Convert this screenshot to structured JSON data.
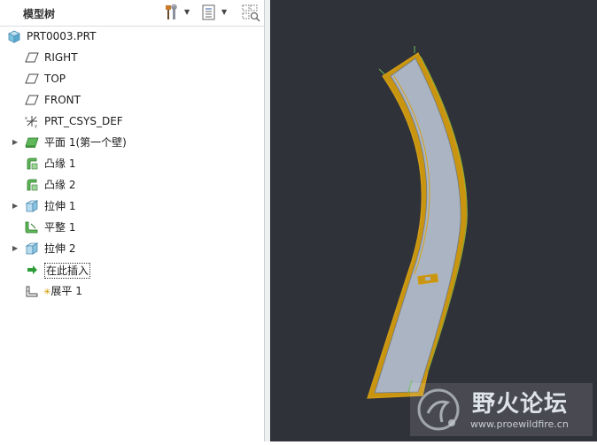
{
  "panel": {
    "title": "模型树"
  },
  "tree": {
    "root": "PRT0003.PRT",
    "items": [
      {
        "label": "RIGHT"
      },
      {
        "label": "TOP"
      },
      {
        "label": "FRONT"
      },
      {
        "label": "PRT_CSYS_DEF"
      },
      {
        "label": "平面 1(第一个壁)"
      },
      {
        "label": "凸缘 1"
      },
      {
        "label": "凸缘 2"
      },
      {
        "label": "拉伸 1"
      },
      {
        "label": "平整 1"
      },
      {
        "label": "拉伸 2"
      },
      {
        "label": "在此插入"
      },
      {
        "label": "展平 1"
      }
    ]
  },
  "watermark": {
    "title": "野火论坛",
    "url": "www.proewildfire.cn"
  },
  "colors": {
    "viewport_bg": "#303239",
    "part_fill": "#aab4c2",
    "edge_highlight": "#d4a017"
  }
}
